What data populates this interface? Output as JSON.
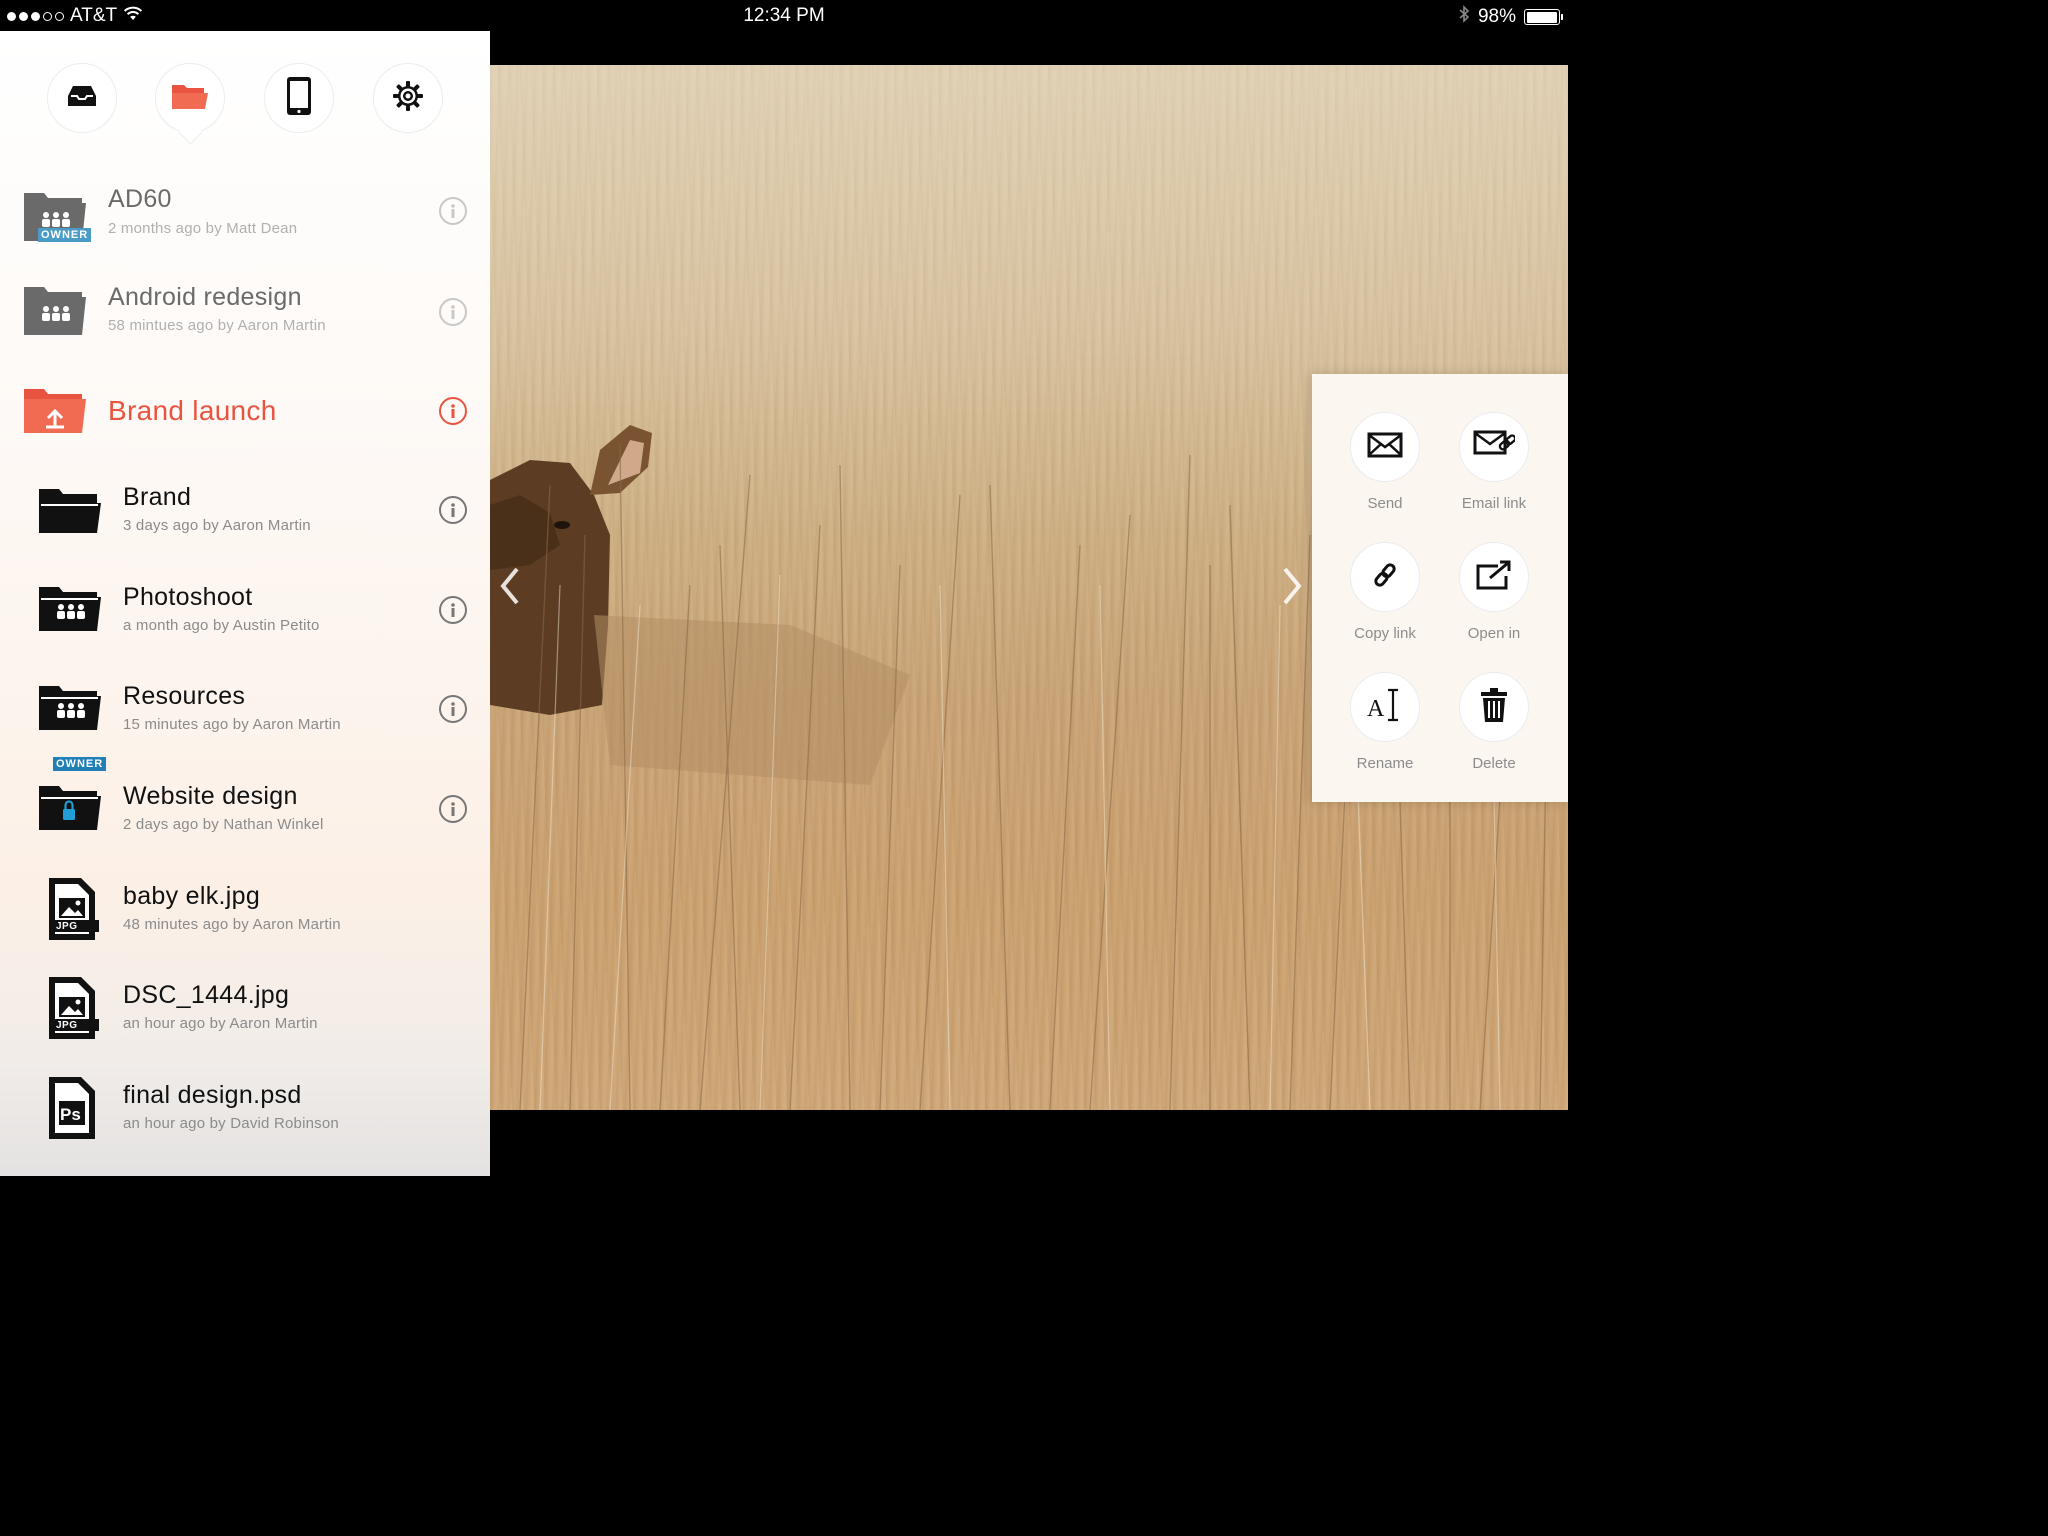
{
  "status_bar": {
    "carrier": "AT&T",
    "time": "12:34 PM",
    "battery_text": "98%",
    "battery_level": 0.98,
    "signal_bars_filled": 3,
    "signal_bars_total": 5
  },
  "nav": {
    "items": [
      {
        "name": "inbox-tab",
        "icon": "inbox-icon",
        "active": false
      },
      {
        "name": "files-tab",
        "icon": "folder-icon",
        "active": true
      },
      {
        "name": "devices-tab",
        "icon": "tablet-icon",
        "active": false
      },
      {
        "name": "settings-tab",
        "icon": "gear-icon",
        "active": false
      }
    ],
    "accent_color": "#e8543f"
  },
  "files": {
    "items": [
      {
        "title": "AD60",
        "subtitle": "2 months ago by Matt Dean",
        "type": "shared-folder",
        "badge": "OWNER",
        "level": 0
      },
      {
        "title": "Android redesign",
        "subtitle": "58 mintues ago by Aaron Martin",
        "type": "shared-folder",
        "level": 0
      },
      {
        "title": "Brand launch",
        "subtitle": "",
        "type": "open-folder",
        "selected": true,
        "level": 0
      },
      {
        "title": "Brand",
        "subtitle": "3 days ago by Aaron Martin",
        "type": "folder",
        "level": 1
      },
      {
        "title": "Photoshoot",
        "subtitle": "a month ago by Austin Petito",
        "type": "shared-folder",
        "level": 1
      },
      {
        "title": "Resources",
        "subtitle": "15 minutes ago by Aaron Martin",
        "type": "shared-folder",
        "badge": "OWNER",
        "level": 1
      },
      {
        "title": "Website design",
        "subtitle": "2 days ago by Nathan Winkel",
        "type": "locked-folder",
        "level": 1
      },
      {
        "title": "baby elk.jpg",
        "subtitle": "48 minutes ago by Aaron Martin",
        "type": "jpg-file",
        "file_tag": "JPG",
        "level": 1
      },
      {
        "title": "DSC_1444.jpg",
        "subtitle": "an hour ago by Aaron Martin",
        "type": "jpg-file",
        "file_tag": "JPG",
        "level": 1
      },
      {
        "title": "final design.psd",
        "subtitle": "an hour ago by David Robinson",
        "type": "psd-file",
        "file_tag": "Ps",
        "level": 1
      }
    ]
  },
  "share_menu": {
    "actions": [
      {
        "label": "Send",
        "icon": "envelope-icon"
      },
      {
        "label": "Email link",
        "icon": "email-link-icon"
      },
      {
        "label": "Copy link",
        "icon": "link-icon"
      },
      {
        "label": "Open in",
        "icon": "open-in-icon"
      },
      {
        "label": "Rename",
        "icon": "rename-icon"
      },
      {
        "label": "Delete",
        "icon": "trash-icon"
      }
    ]
  },
  "viewer": {
    "image_subject": "baby elk.jpg"
  }
}
